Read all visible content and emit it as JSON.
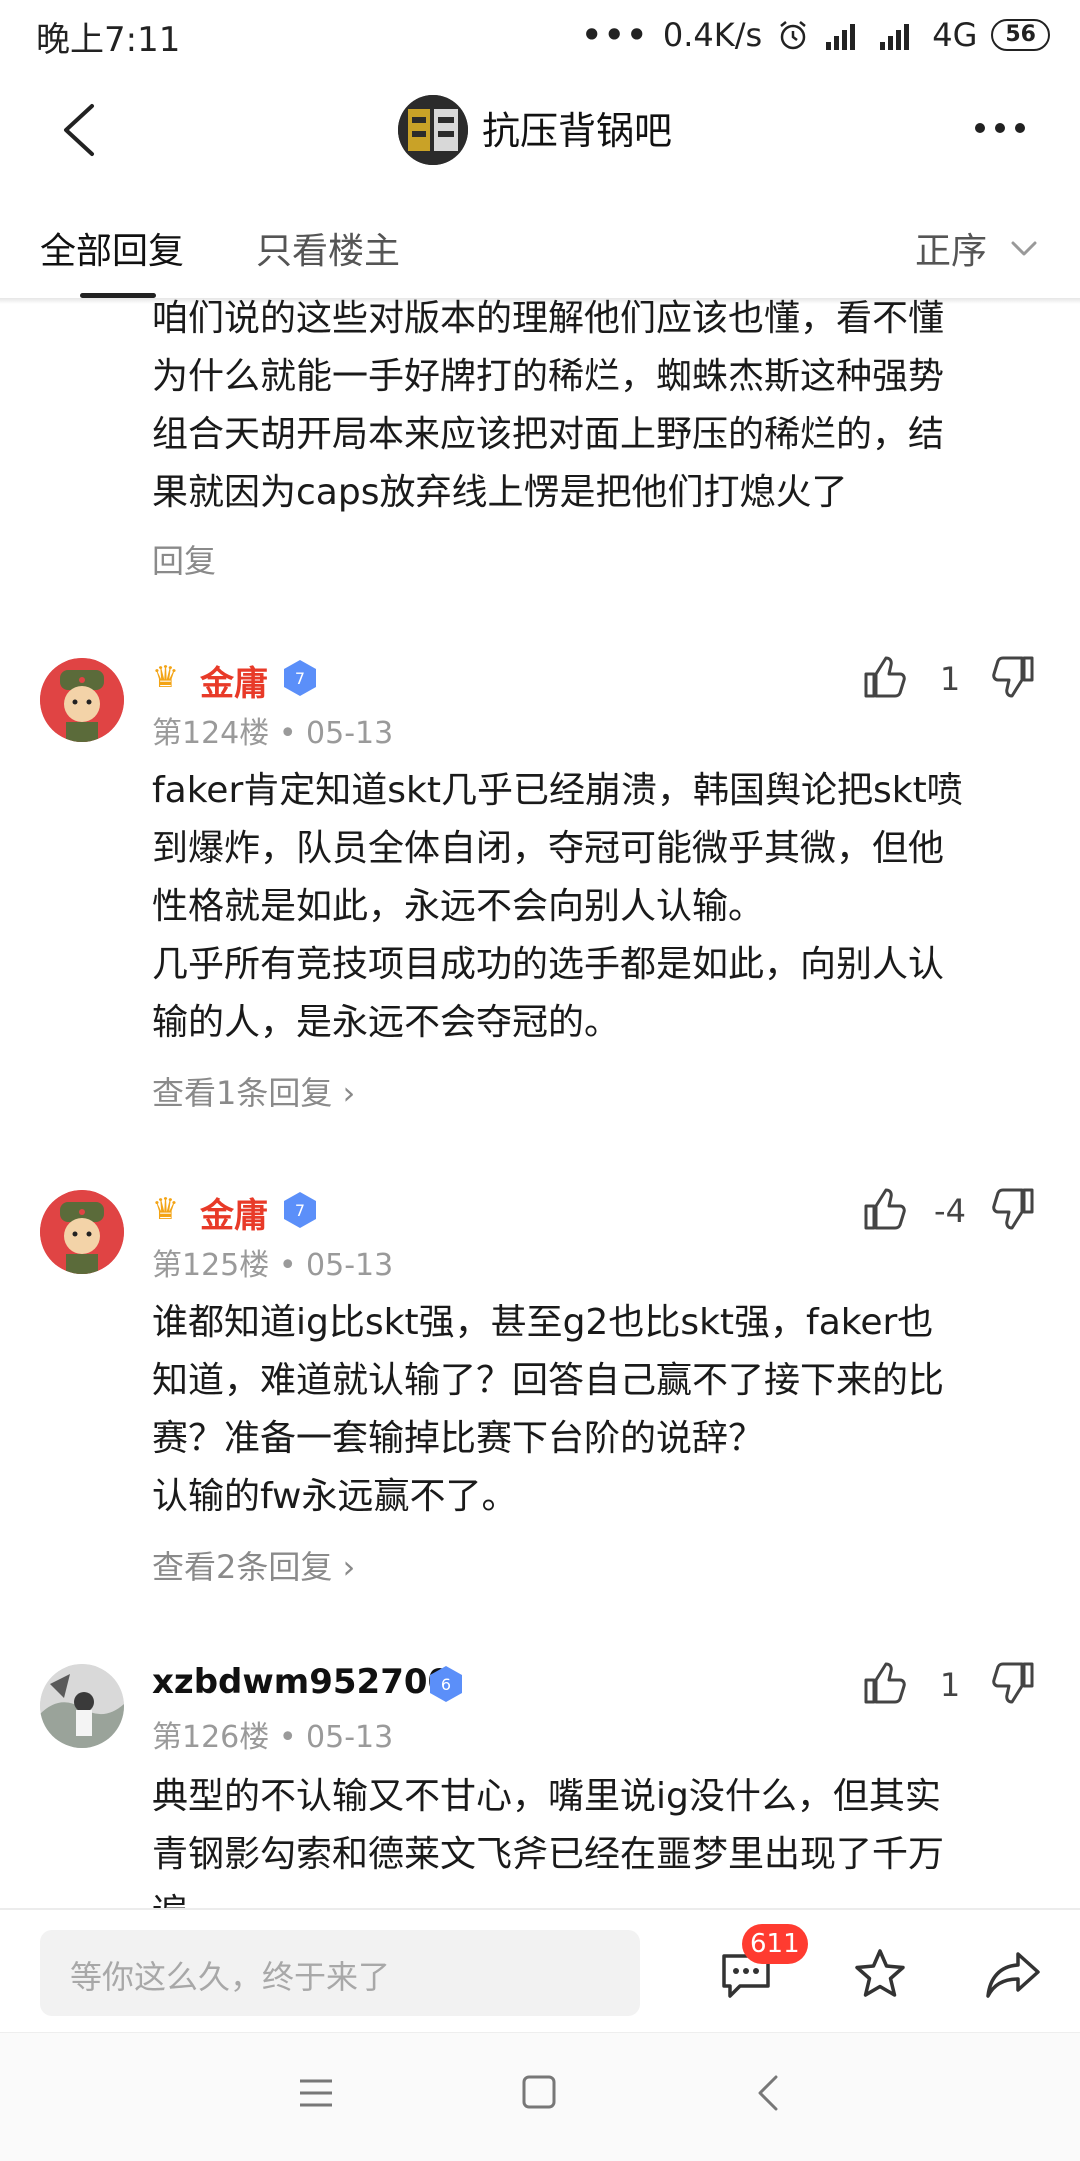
{
  "status_bar": {
    "time": "晚上7:11",
    "dots": "•••",
    "net_speed": "0.4K/s",
    "network": "4G",
    "battery": "56"
  },
  "header": {
    "title": "抗压背锅吧"
  },
  "tabs": {
    "all_replies": "全部回复",
    "op_only": "只看楼主",
    "sort": "正序"
  },
  "partial_post": {
    "lines": [
      "咱们说的这些对版本的理解他们应该也懂，看不懂",
      "为什么就能一手好牌打的稀烂，蜘蛛杰斯这种强势",
      "组合天胡开局本来应该把对面上野压的稀烂的，结",
      "果就因为caps放弃线上愣是把他们打熄火了"
    ],
    "reply_label": "回复"
  },
  "comments": [
    {
      "username": "金庸",
      "level": "7",
      "floor": "第124楼",
      "date": "05-13",
      "likes": "1",
      "lines": [
        "faker肯定知道skt几乎已经崩溃，韩国舆论把skt喷",
        "到爆炸，队员全体自闭，夺冠可能微乎其微，但他",
        "性格就是如此，永远不会向别人认输。",
        "几乎所有竞技项目成功的选手都是如此，向别人认",
        "输的人，是永远不会夺冠的。"
      ],
      "reply_link": "查看1条回复 ›"
    },
    {
      "username": "金庸",
      "level": "7",
      "floor": "第125楼",
      "date": "05-13",
      "likes": "-4",
      "lines": [
        "谁都知道ig比skt强，甚至g2也比skt强，faker也",
        "知道，难道就认输了？回答自己赢不了接下来的比",
        "赛？准备一套输掉比赛下台阶的说辞？",
        "认输的fw永远赢不了。"
      ],
      "reply_link": "查看2条回复 ›"
    },
    {
      "username": "xzbdwm952700",
      "level": "6",
      "floor": "第126楼",
      "date": "05-13",
      "likes": "1",
      "lines": [
        "典型的不认输又不甘心，嘴里说ig没什么，但其实",
        "青钢影勾索和德莱文飞斧已经在噩梦里出现了千万",
        "遍"
      ]
    }
  ],
  "bottom_bar": {
    "input_placeholder": "等你这么久，终于来了",
    "comment_count": "611"
  },
  "colors": {
    "username_red": "#e83a28",
    "badge_red": "#ff3b30",
    "level_blue": "#5b8ff9",
    "meta_gray": "#9a9a9a"
  },
  "icons": [
    "back-icon",
    "more-icon",
    "chevron-down-icon",
    "crown-icon",
    "level-badge-icon",
    "thumbs-up-icon",
    "thumbs-down-icon",
    "chat-icon",
    "star-icon",
    "share-icon",
    "menu-icon",
    "home-icon",
    "nav-back-icon"
  ]
}
